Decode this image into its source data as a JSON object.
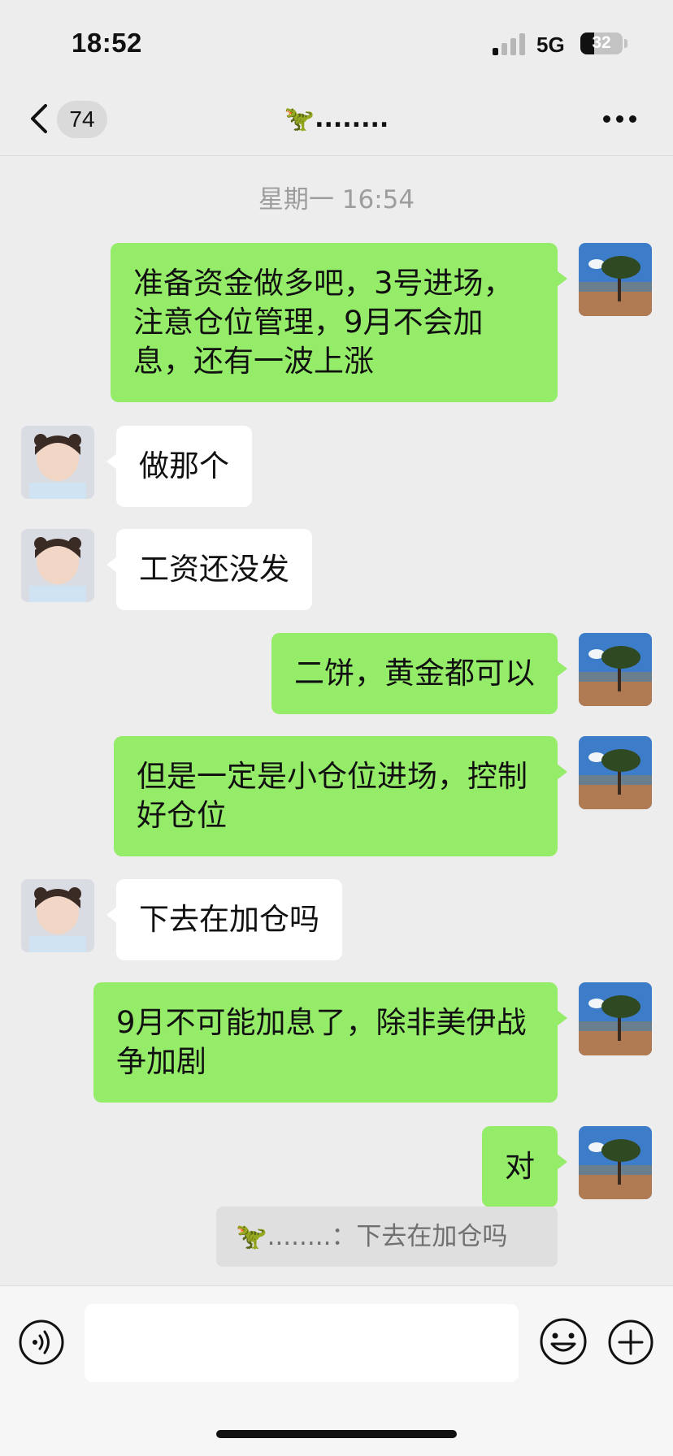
{
  "status_bar": {
    "time": "18:52",
    "network": "5G",
    "battery": "32"
  },
  "nav": {
    "unread_count": "74",
    "title": "🦖........"
  },
  "chat": {
    "timestamp": "星期一 16:54",
    "messages": [
      {
        "side": "out",
        "text": "准备资金做多吧，3号进场，注意仓位管理，9月不会加息，还有一波上涨"
      },
      {
        "side": "in",
        "text": "做那个"
      },
      {
        "side": "in",
        "text": "工资还没发"
      },
      {
        "side": "out",
        "text": "二饼，黄金都可以"
      },
      {
        "side": "out",
        "text": "但是一定是小仓位进场，控制好仓位"
      },
      {
        "side": "in",
        "text": "下去在加仓吗"
      },
      {
        "side": "out",
        "text": "9月不可能加息了，除非美伊战争加剧"
      },
      {
        "side": "out",
        "text": "对"
      }
    ],
    "quote": "🦖........：下去在加仓吗"
  },
  "input_bar": {
    "text_value": "",
    "icons": [
      "voice-icon",
      "emoji-icon",
      "plus-icon"
    ]
  },
  "colors": {
    "outgoing_bubble": "#95ec69",
    "incoming_bubble": "#ffffff",
    "background": "#ededed"
  }
}
